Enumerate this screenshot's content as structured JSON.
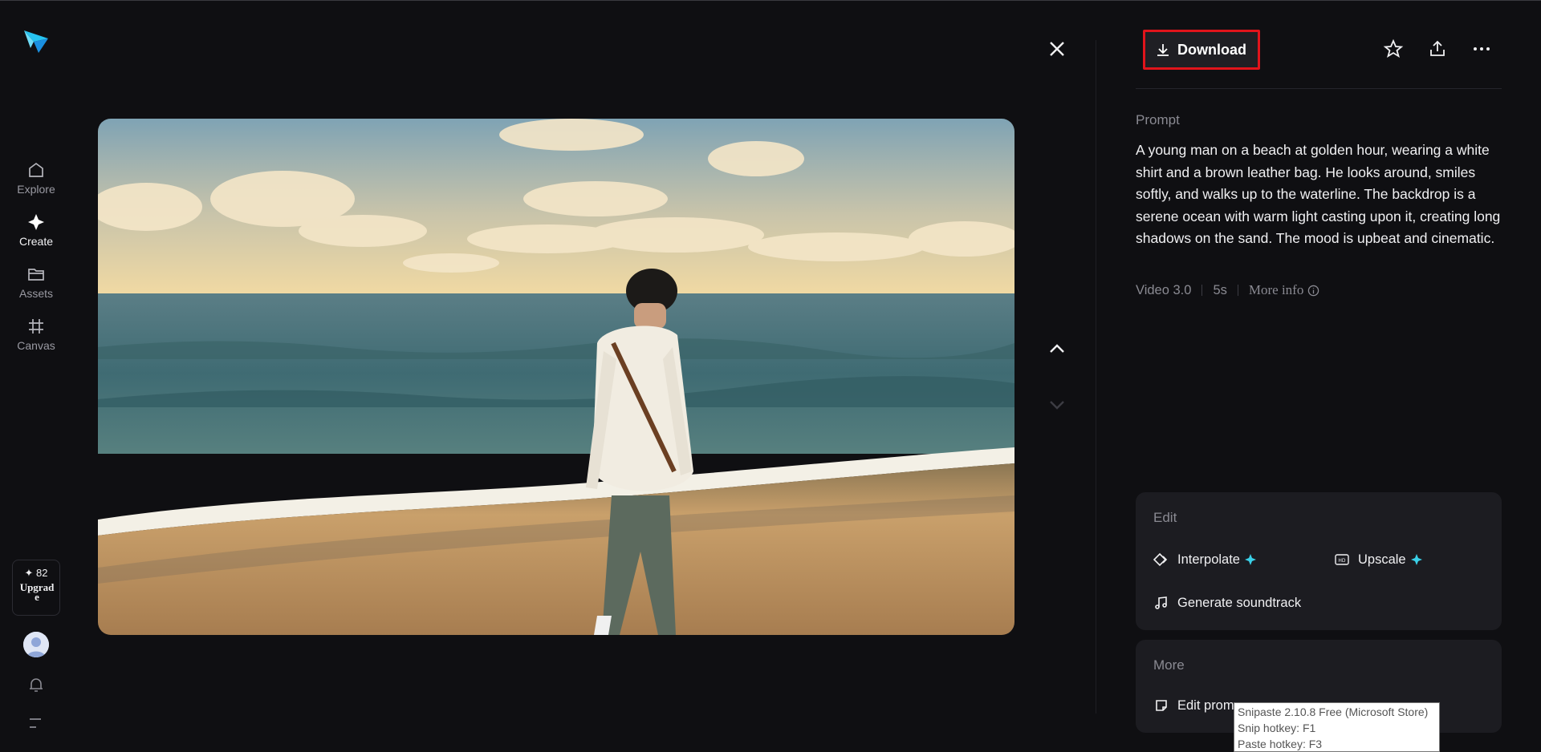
{
  "sidebar": {
    "logo_icon": "paper-plane-logo",
    "items": [
      {
        "label": "Explore",
        "icon": "home-icon"
      },
      {
        "label": "Create",
        "icon": "sparkle-icon"
      },
      {
        "label": "Assets",
        "icon": "folder-icon"
      },
      {
        "label": "Canvas",
        "icon": "grid-icon"
      }
    ],
    "credits": "✦ 82",
    "upgrade": "Upgrade"
  },
  "viewer": {
    "close_icon": "close-icon",
    "prev_icon": "chevron-up-icon",
    "next_icon": "chevron-down-icon",
    "video_alt": "video-preview"
  },
  "toolbar": {
    "download_label": "Download",
    "favorite_icon": "star-icon",
    "share_icon": "share-icon",
    "more_icon": "ellipsis-icon"
  },
  "details": {
    "prompt_label": "Prompt",
    "prompt_text": "A young man on a beach at golden hour, wearing a white shirt and a brown leather bag. He looks around, smiles softly, and walks up to the waterline. The backdrop is a serene ocean with warm light casting upon it, creating long shadows on the sand. The mood is upbeat and cinematic.",
    "model": "Video 3.0",
    "duration": "5s",
    "more_info": "More info"
  },
  "edit_card": {
    "title": "Edit",
    "actions": {
      "interpolate": "Interpolate",
      "upscale": "Upscale",
      "soundtrack": "Generate soundtrack"
    }
  },
  "more_card": {
    "title": "More",
    "edit_prompt": "Edit prom"
  },
  "tooltip": {
    "line1": "Snipaste 2.10.8 Free (Microsoft Store)",
    "line2": "Snip hotkey: F1",
    "line3": "Paste hotkey: F3"
  },
  "colors": {
    "background": "#0f0f12",
    "card": "#1c1c21",
    "highlight_border": "#e1141b",
    "accent_sparkle": "#3ad0e8"
  }
}
